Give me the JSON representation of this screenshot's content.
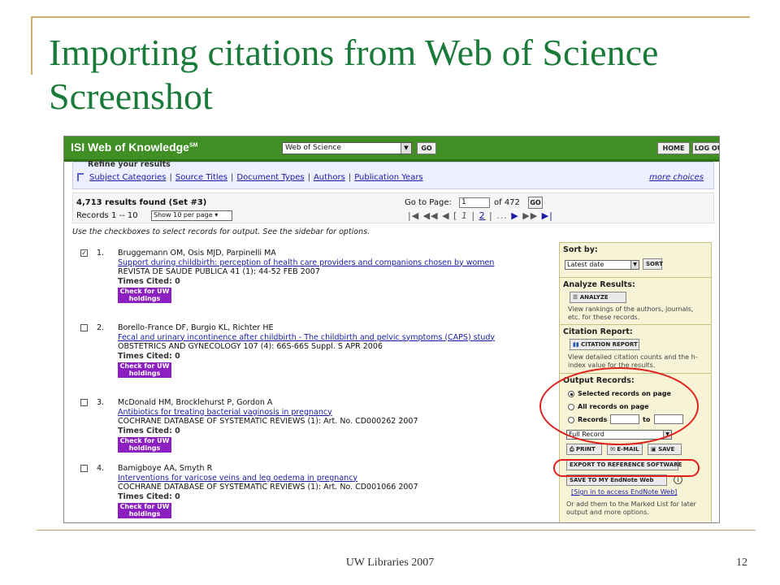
{
  "slide": {
    "title": "Importing citations from Web of Science Screenshot",
    "footer": "UW Libraries 2007",
    "page_number": "12"
  },
  "app": {
    "logo": "ISI Web of Knowledge",
    "logo_mark": "SM",
    "database": "Web of Science",
    "go_label": "GO",
    "home_label": "HOME",
    "logout_label": "LOG OU"
  },
  "refine": {
    "heading": "Refine your results",
    "links": [
      "Subject Categories",
      "Source Titles",
      "Document Types",
      "Authors",
      "Publication Years"
    ],
    "more": "more choices"
  },
  "results": {
    "found": "4,713 results found (Set #3)",
    "records": "Records 1 -- 10",
    "per_page": "Show 10 per page",
    "goto_label": "Go to Page:",
    "goto_value": "1",
    "of_pages": "of 472",
    "go_label": "GO",
    "current_page": "1",
    "next_page": "2",
    "ellipsis": "..."
  },
  "instructions": "Use the checkboxes to select records for output. See the sidebar for options.",
  "records": [
    {
      "num": "1.",
      "checked": true,
      "authors": "Bruggemann OM, Osis MJD, Parpinelli MA",
      "title": "Support during childbirth: perception of health care providers and companions chosen by women",
      "source": "REVISTA DE SAUDE PUBLICA 41 (1): 44-52 FEB 2007",
      "cited": "Times Cited: 0",
      "holdings": "Check for UW holdings"
    },
    {
      "num": "2.",
      "checked": false,
      "authors": "Borello-France DF, Burgio KL, Richter HE",
      "title": "Fecal and urinary incontinence after childbirth - The childbirth and pelvic symptoms (CAPS) study",
      "source": "OBSTETRICS AND GYNECOLOGY 107 (4): 66S-66S Suppl. S APR 2006",
      "cited": "Times Cited: 0",
      "holdings": "Check for UW holdings"
    },
    {
      "num": "3.",
      "checked": false,
      "authors": "McDonald HM, Brocklehurst P, Gordon A",
      "title": "Antibiotics for treating bacterial vaginosis in pregnancy",
      "source": "COCHRANE DATABASE OF SYSTEMATIC REVIEWS (1): Art. No. CD000262 2007",
      "cited": "Times Cited: 0",
      "holdings": "Check for UW holdings"
    },
    {
      "num": "4.",
      "checked": false,
      "authors": "Bamigboye AA, Smyth R",
      "title": "Interventions for varicose veins and leg oedema in pregnancy",
      "source": "COCHRANE DATABASE OF SYSTEMATIC REVIEWS (1): Art. No. CD001066 2007",
      "cited": "Times Cited: 0",
      "holdings": "Check for UW holdings"
    }
  ],
  "sidebar": {
    "sort_heading": "Sort by:",
    "sort_value": "Latest date",
    "sort_button": "SORT",
    "analyze_heading": "Analyze Results:",
    "analyze_button": "ANALYZE",
    "analyze_text": "View rankings of the authors, journals, etc. for these records.",
    "citation_heading": "Citation Report:",
    "citation_button": "CITATION REPORT",
    "citation_text": "View detailed citation counts and the h-index value for the results.",
    "output_heading": "Output Records:",
    "opt_selected": "Selected records on page",
    "opt_all": "All records on page",
    "opt_records": "Records",
    "opt_to": "to",
    "format": "Full Record",
    "print": "PRINT",
    "email": "E-MAIL",
    "save": "SAVE",
    "export": "EXPORT TO REFERENCE SOFTWARE",
    "endnote_btn": "SAVE TO MY EndNote Web",
    "endnote_link": "Sign in to access EndNote Web",
    "marked_text": "Or add them to the Marked List for later output and more options."
  }
}
